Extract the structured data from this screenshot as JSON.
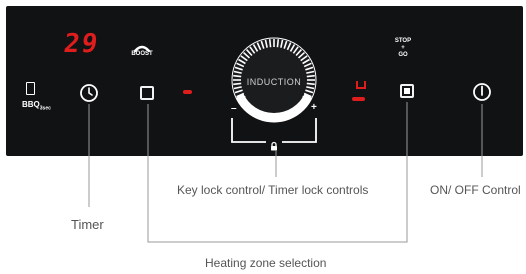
{
  "panel": {
    "timer_display": "29",
    "boost_label": "BOOST",
    "bbq_label": "BBQ",
    "bbq_sub": "3sec",
    "dial_label": "INDUCTION",
    "dial_minus": "–",
    "dial_plus": "+",
    "right_zone_display": "ᑌ",
    "stop_go_label": [
      "STOP",
      "+",
      "GO"
    ]
  },
  "annotations": {
    "key_lock": "Key lock control/ Timer lock controls",
    "on_off": "ON/ OFF Control",
    "timer": "Timer",
    "heating_zone": "Heating zone selection"
  },
  "colors": {
    "panel_bg": "#111214",
    "display_red": "#e01d1d",
    "line_gray": "#9a9a9a"
  }
}
